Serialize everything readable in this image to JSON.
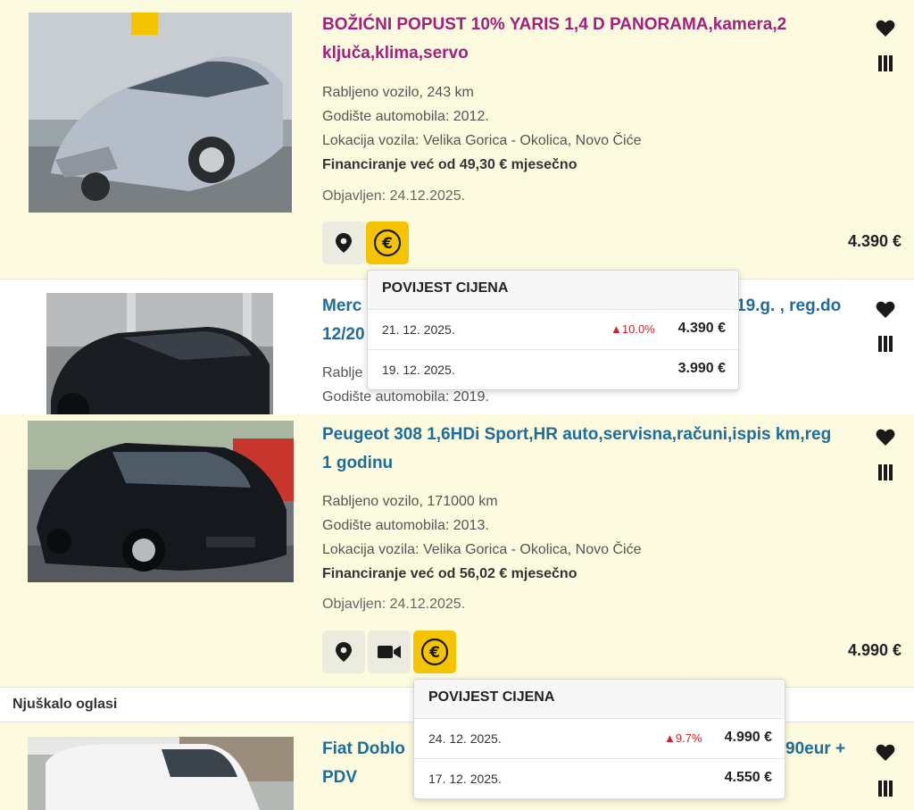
{
  "listings": [
    {
      "title": "BOŽIĆNI POPUST 10% YARIS 1,4 D PANORAMA,kamera,2 ključa,klima,servo",
      "condition": "Rabljeno vozilo, 243 km",
      "year": "Godište automobila: 2012.",
      "location": "Lokacija vozila: Velika Gorica - Okolica, Novo Čiće",
      "financing": "Financiranje već od 49,30 € mjesečno",
      "published": "Objavljen: 24.12.2025.",
      "price": "4.390 €",
      "car_color": "#b5bec8"
    },
    {
      "title": "Merc",
      "title_right": "19.g. , reg.do",
      "title_line2": "12/20",
      "condition": "Rablje",
      "year": "Godište automobila: 2019.",
      "car_color": "#1a1d22"
    },
    {
      "title": "Peugeot 308 1,6HDi Sport,HR auto,servisna,računi,ispis km,reg 1 godinu",
      "condition": "Rabljeno vozilo, 171000 km",
      "year": "Godište automobila: 2013.",
      "location": "Lokacija vozila: Velika Gorica - Okolica, Novo Čiće",
      "financing": "Financiranje već od 56,02 € mjesečno",
      "published": "Objavljen: 24.12.2025.",
      "price": "4.990 €",
      "car_color": "#15181d"
    },
    {
      "title": "Fiat Doblo",
      "title_right": "90eur +",
      "title_line2": "PDV",
      "car_color": "#f4f4f4"
    }
  ],
  "section_label": "Njuškalo oglasi",
  "price_history_popups": [
    {
      "header": "POVIJEST CIJENA",
      "rows": [
        {
          "date": "21. 12. 2025.",
          "change": "▲10.0%",
          "price": "4.390 €"
        },
        {
          "date": "19. 12. 2025.",
          "change": "",
          "price": "3.990 €"
        }
      ]
    },
    {
      "header": "POVIJEST CIJENA",
      "rows": [
        {
          "date": "24. 12. 2025.",
          "change": "▲9.7%",
          "price": "4.990 €"
        },
        {
          "date": "17. 12. 2025.",
          "change": "",
          "price": "4.550 €"
        }
      ]
    }
  ],
  "icons": {
    "map": "map-pin-icon",
    "video": "video-camera-icon",
    "euro": "euro-icon",
    "favorite": "heart-icon",
    "compare": "compare-bars-icon"
  },
  "colors": {
    "promo_title": "#a2217e",
    "regular_title": "#1e6d99",
    "highlight_bg": "#fdfbdf",
    "euro_button": "#f5c400",
    "price_up": "#c3272b"
  }
}
